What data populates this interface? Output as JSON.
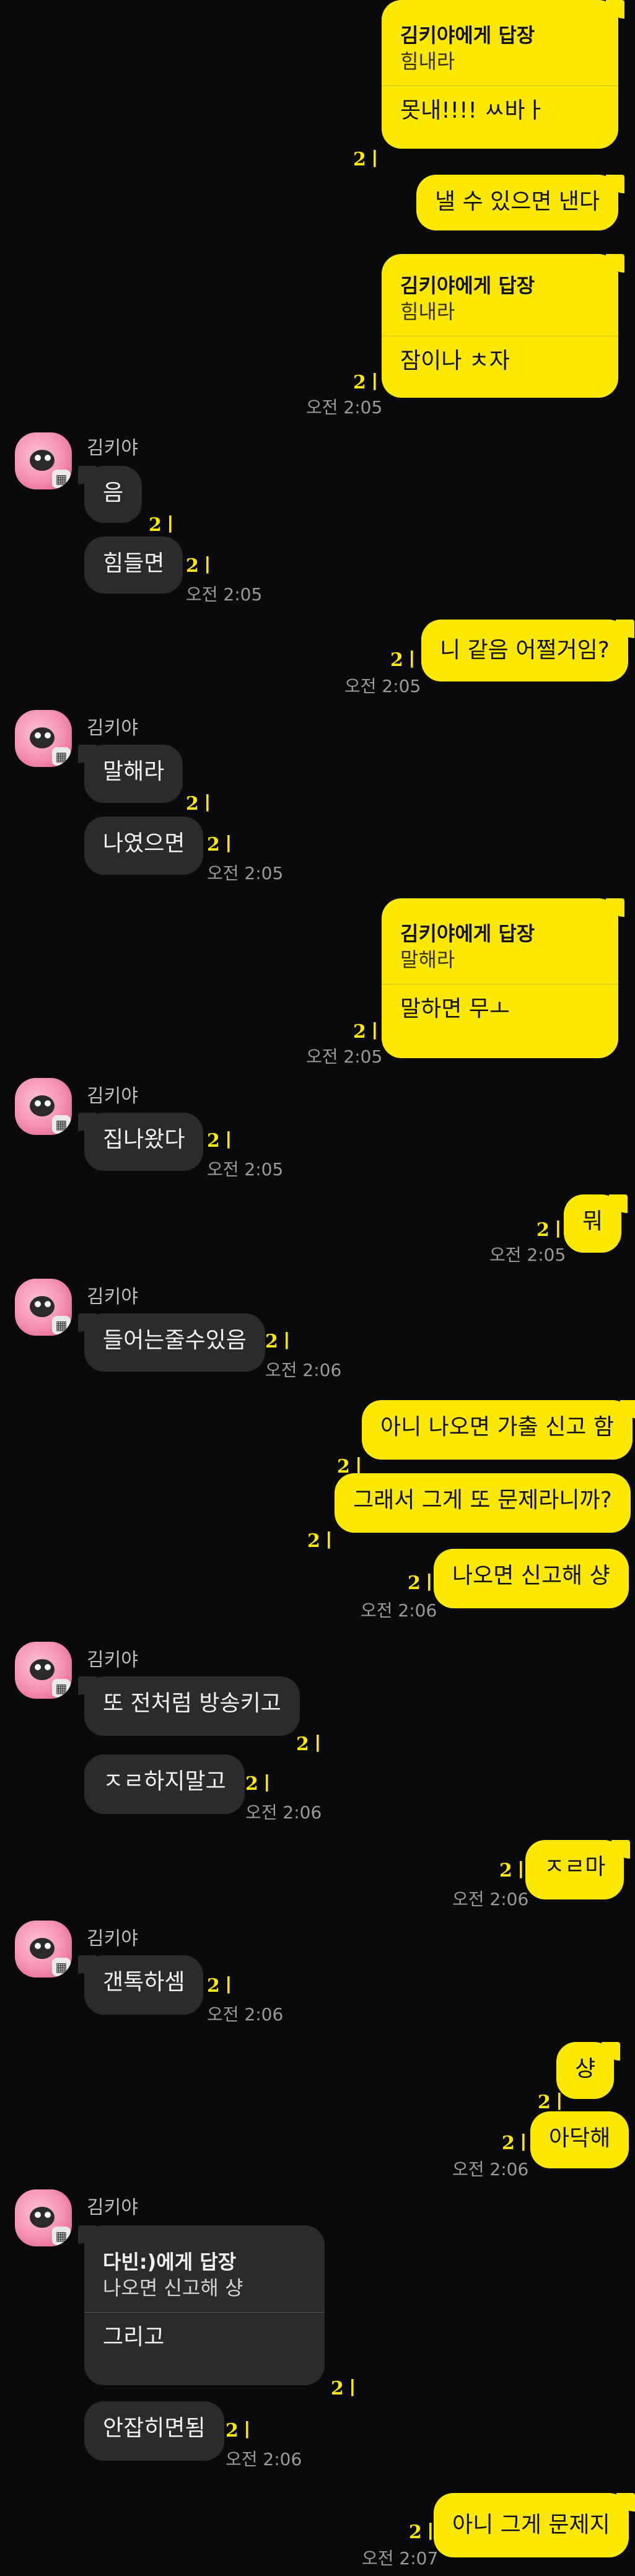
{
  "contact": "김키야",
  "read_mark": "2ㅣ",
  "messages": {
    "m1": {
      "reply_to": "김키야에게 답장",
      "quote": "힘내라",
      "text": "못내!!!! ㅆ바ㅏ"
    },
    "m2": {
      "text": "낼 수 있으면 낸다"
    },
    "m3": {
      "reply_to": "김키야에게 답장",
      "quote": "힘내라",
      "text": "잠이나 ㅊ자",
      "time": "오전 2:05"
    },
    "m4": {
      "text": "음"
    },
    "m5": {
      "text": "힘들면",
      "time": "오전 2:05"
    },
    "m6": {
      "text": "니 같음 어쩔거임?",
      "time": "오전 2:05"
    },
    "m7": {
      "text": "말해라"
    },
    "m8": {
      "text": "나였으면",
      "time": "오전 2:05"
    },
    "m9": {
      "reply_to": "김키야에게 답장",
      "quote": "말해라",
      "text": "말하면 무ㅗ",
      "time": "오전 2:05"
    },
    "m10": {
      "text": "집나왔다",
      "time": "오전 2:05"
    },
    "m11": {
      "text": "뭐",
      "time": "오전 2:05"
    },
    "m12": {
      "text": "들어는줄수있음",
      "time": "오전 2:06"
    },
    "m13": {
      "text": "아니 나오면 가출 신고 함"
    },
    "m14": {
      "text": "그래서 그게 또 문제라니까?"
    },
    "m15": {
      "text": "나오면 신고해 샹",
      "time": "오전 2:06"
    },
    "m16": {
      "text": "또 전처럼 방송키고"
    },
    "m17": {
      "text": "ㅈㄹ하지말고",
      "time": "오전 2:06"
    },
    "m18": {
      "text": "ㅈㄹ마",
      "time": "오전 2:06"
    },
    "m19": {
      "text": "갠톡하셈",
      "time": "오전 2:06"
    },
    "m20": {
      "text": "샹"
    },
    "m21": {
      "text": "아닥해",
      "time": "오전 2:06"
    },
    "m22": {
      "reply_to": "다빈:)에게 답장",
      "quote": "나오면 신고해 샹",
      "text": "그리고"
    },
    "m23": {
      "text": "안잡히면됨",
      "time": "오전 2:06"
    },
    "m24": {
      "text": "아니 그게 문제지",
      "time": "오전 2:07"
    }
  },
  "colors": {
    "my_bubble": "#fde900",
    "their_bubble": "#2b2b2e",
    "background": "#0a0a0b",
    "read_mark": "#fde900"
  },
  "icons": {
    "avatar": "pink-character-avatar",
    "avatar_badge": "calendar-badge-icon"
  }
}
